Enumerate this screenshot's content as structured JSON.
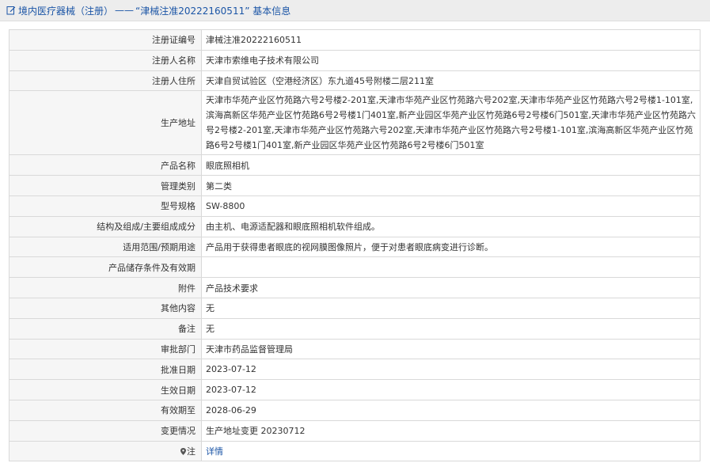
{
  "header": {
    "prefix": "境内医疗器械（注册）",
    "separator": "——",
    "title": "“津械注准20222160511” 基本信息"
  },
  "rows": [
    {
      "label": "注册证编号",
      "value": "津械注准20222160511"
    },
    {
      "label": "注册人名称",
      "value": "天津市索维电子技术有限公司"
    },
    {
      "label": "注册人住所",
      "value": "天津自贸试验区（空港经济区）东九道45号附楼二层211室"
    },
    {
      "label": "生产地址",
      "value": "天津市华苑产业区竹苑路六号2号楼2-201室,天津市华苑产业区竹苑路六号202室,天津市华苑产业区竹苑路六号2号楼1-101室,滨海高新区华苑产业区竹苑路6号2号楼1门401室,新产业园区华苑产业区竹苑路6号2号楼6门501室,天津市华苑产业区竹苑路六号2号楼2-201室,天津市华苑产业区竹苑路六号202室,天津市华苑产业区竹苑路六号2号楼1-101室,滨海高新区华苑产业区竹苑路6号2号楼1门401室,新产业园区华苑产业区竹苑路6号2号楼6门501室"
    },
    {
      "label": "产品名称",
      "value": "眼底照相机"
    },
    {
      "label": "管理类别",
      "value": "第二类"
    },
    {
      "label": "型号规格",
      "value": "SW-8800"
    },
    {
      "label": "结构及组成/主要组成成分",
      "value": "由主机、电源适配器和眼底照相机软件组成。"
    },
    {
      "label": "适用范围/预期用途",
      "value": "产品用于获得患者眼底的视网膜图像照片，便于对患者眼底病变进行诊断。"
    },
    {
      "label": "产品储存条件及有效期",
      "value": ""
    },
    {
      "label": "附件",
      "value": "产品技术要求"
    },
    {
      "label": "其他内容",
      "value": "无"
    },
    {
      "label": "备注",
      "value": "无"
    },
    {
      "label": "审批部门",
      "value": "天津市药品监督管理局"
    },
    {
      "label": "批准日期",
      "value": "2023-07-12"
    },
    {
      "label": "生效日期",
      "value": "2023-07-12"
    },
    {
      "label": "有效期至",
      "value": "2028-06-29"
    },
    {
      "label": "变更情况",
      "value": "生产地址变更 20230712"
    }
  ],
  "note": {
    "label": "注",
    "link": "详情",
    "icon": "pin-icon"
  },
  "colors": {
    "link": "#1b55a6",
    "label_bg": "#f6f6f6",
    "header_bg": "#ededed"
  }
}
